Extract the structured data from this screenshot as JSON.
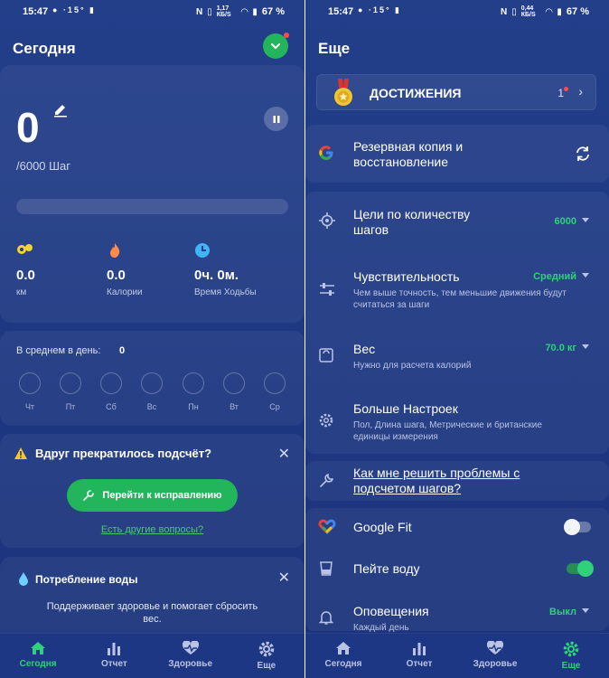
{
  "status_bar": {
    "time": "15:47",
    "extra": "·15°",
    "net_speed_left": "1,17 КБ/S",
    "net_speed_right": "0,44 КБ/S",
    "battery": "67 %"
  },
  "today": {
    "title": "Сегодня",
    "steps": "0",
    "goal": "/6000 Шаг",
    "progress": 0,
    "stats": [
      {
        "value": "0.0",
        "label": "км",
        "icon": "footsteps-icon",
        "color": "#f5d431"
      },
      {
        "value": "0.0",
        "label": "Калории",
        "icon": "flame-icon",
        "color": "#ff8a4c"
      },
      {
        "value": "0ч. 0м.",
        "label": "Время Ходьбы",
        "icon": "clock-icon",
        "color": "#3fb6f2"
      }
    ],
    "average_label": "В среднем в день:",
    "average_value": "0",
    "days": [
      "Чт",
      "Пт",
      "Сб",
      "Вс",
      "Пн",
      "Вт",
      "Ср"
    ],
    "warning": {
      "title": "Вдруг прекратилось подсчёт?",
      "button": "Перейти к исправлению",
      "link": "Есть другие вопросы?"
    },
    "water": {
      "title": "Потребление воды",
      "description": "Поддерживает здоровье и помогает сбросить вес."
    }
  },
  "more": {
    "title": "Еще",
    "achievements": {
      "title": "ДОСТИЖЕНИЯ",
      "count": "1"
    },
    "backup": {
      "title": "Резервная копия и восстановление"
    },
    "step_goal": {
      "title": "Цели по количеству шагов",
      "value": "6000"
    },
    "sensitivity": {
      "title": "Чувствительность",
      "value": "Средний",
      "subtitle": "Чем выше точность, тем меньшие движения будут считаться за шаги"
    },
    "weight": {
      "title": "Вес",
      "value": "70.0 кг",
      "subtitle": "Нужно для расчета калорий"
    },
    "more_settings": {
      "title": "Больше Настроек",
      "subtitle": "Пол, Длина шага, Метрические и британские единицы измерения"
    },
    "help": {
      "title": "Как мне решить проблемы с подсчетом шагов?"
    },
    "google_fit": {
      "title": "Google Fit",
      "enabled": false
    },
    "drink_water": {
      "title": "Пейте воду",
      "enabled": true
    },
    "notifications": {
      "title": "Оповещения",
      "value": "Выкл",
      "subtitle": "Каждый день"
    }
  },
  "nav": {
    "today": "Сегодня",
    "report": "Отчет",
    "health": "Здоровье",
    "more": "Еще"
  },
  "colors": {
    "accent": "#22b55b",
    "background": "#1f3a86",
    "link": "#4fc47a"
  }
}
